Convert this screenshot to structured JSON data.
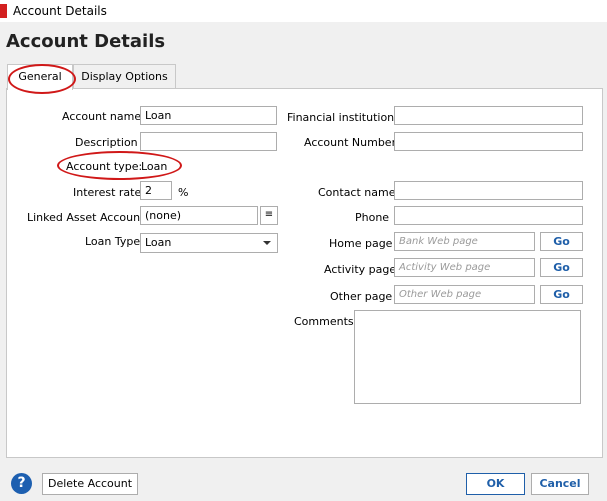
{
  "window": {
    "title": "Account Details"
  },
  "page": {
    "heading": "Account Details"
  },
  "tabs": {
    "general": "General",
    "display": "Display Options"
  },
  "left": {
    "account_name_label": "Account name",
    "account_name_value": "Loan",
    "description_label": "Description",
    "description_value": "",
    "account_type_label": "Account type:",
    "account_type_value": "Loan",
    "interest_rate_label": "Interest rate",
    "interest_rate_value": "2",
    "percent": "%",
    "linked_asset_label": "Linked Asset Account",
    "linked_asset_value": "(none)",
    "loan_type_label": "Loan Type",
    "loan_type_value": "Loan"
  },
  "right": {
    "financial_institution_label": "Financial institution",
    "account_number_label": "Account Number",
    "contact_name_label": "Contact name",
    "phone_label": "Phone",
    "home_page_label": "Home page",
    "home_page_placeholder": "Bank Web page",
    "activity_page_label": "Activity page",
    "activity_page_placeholder": "Activity Web page",
    "other_page_label": "Other page",
    "other_page_placeholder": "Other Web page",
    "go_label": "Go",
    "comments_label": "Comments"
  },
  "footer": {
    "help": "?",
    "delete": "Delete Account",
    "ok": "OK",
    "cancel": "Cancel"
  },
  "colors": {
    "annotation": "#d01818",
    "link": "#1f5fa9",
    "help_bg": "#1d5fb0"
  }
}
